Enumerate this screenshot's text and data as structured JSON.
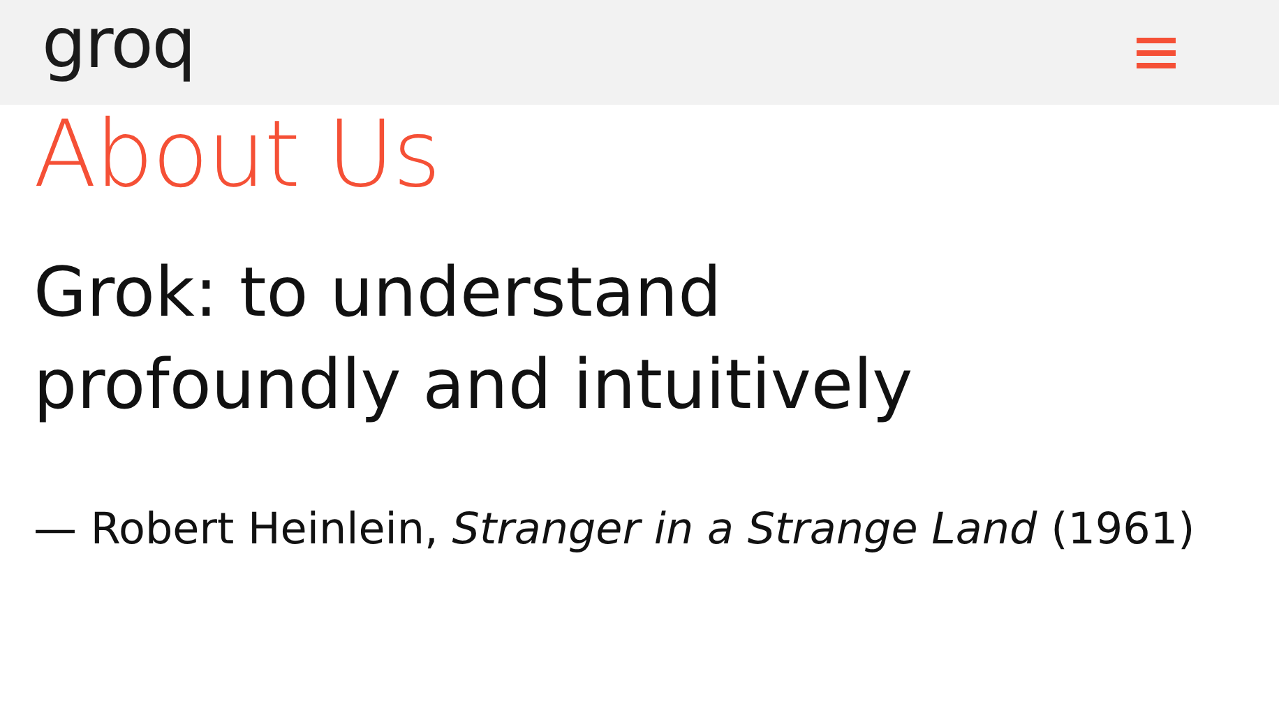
{
  "header": {
    "logo": "groq"
  },
  "page": {
    "heading": "About Us",
    "definition": "Grok: to understand profoundly and intuitively",
    "attribution": "— Robert Heinlein, *Stranger in a Strange Land* (1961)"
  }
}
